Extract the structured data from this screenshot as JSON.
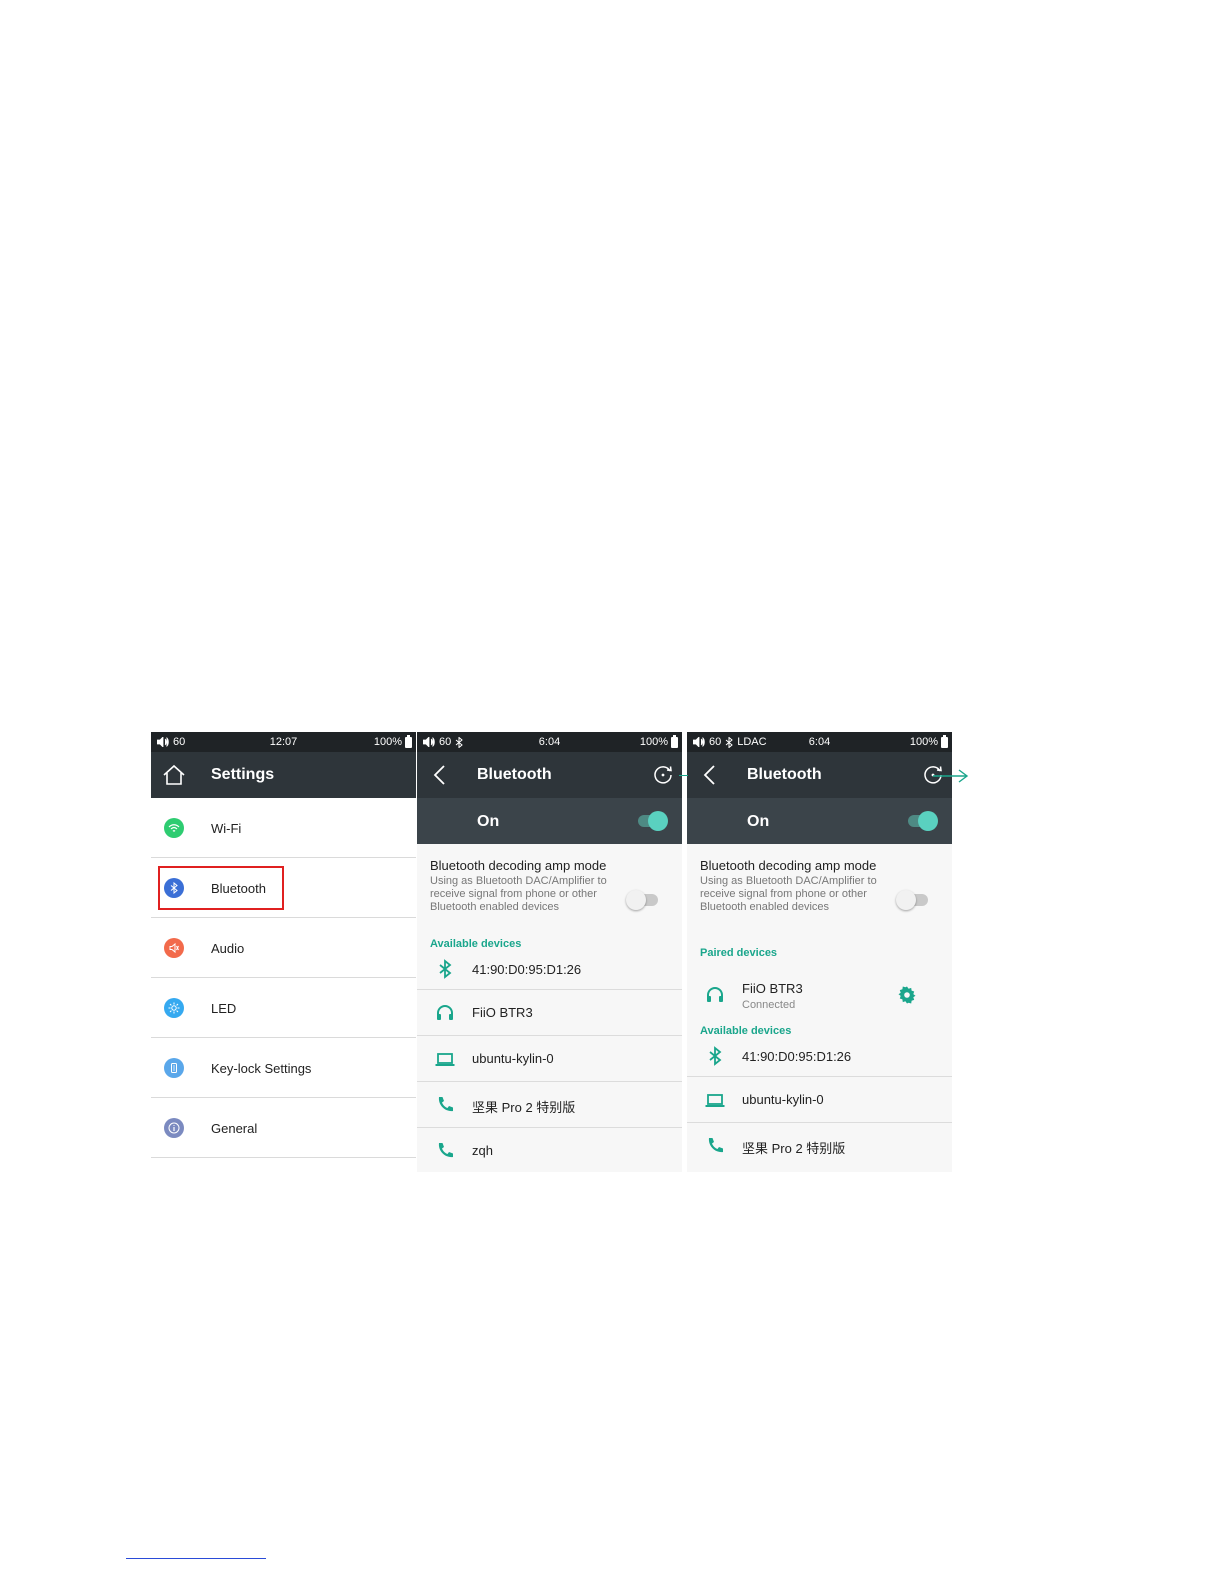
{
  "screens": [
    {
      "status": {
        "volume": "60",
        "bt_codec": "",
        "time": "12:07",
        "battery": "100%"
      },
      "header": {
        "title": "Settings",
        "nav_icon": "home-icon"
      },
      "menu": [
        {
          "label": "Wi-Fi",
          "icon": "wifi-icon",
          "color": "#2ecc71"
        },
        {
          "label": "Bluetooth",
          "icon": "bluetooth-icon",
          "color": "#3b6fd6",
          "highlighted": true
        },
        {
          "label": "Audio",
          "icon": "speaker-icon",
          "color": "#f26a4b"
        },
        {
          "label": "LED",
          "icon": "light-icon",
          "color": "#35a9f0"
        },
        {
          "label": "Key-lock Settings",
          "icon": "lock-icon",
          "color": "#5aa7ea"
        },
        {
          "label": "General",
          "icon": "info-icon",
          "color": "#7b8ac0"
        }
      ]
    },
    {
      "status": {
        "volume": "60",
        "bt_codec": "",
        "time": "6:04",
        "battery": "100%"
      },
      "header": {
        "title": "Bluetooth",
        "nav_icon": "back-icon",
        "action_icon": "refresh-icon"
      },
      "toggle": {
        "label": "On",
        "state": true
      },
      "amp": {
        "title": "Bluetooth decoding amp mode",
        "desc": "Using as Bluetooth DAC/Amplifier to receive signal from phone or other Bluetooth enabled devices",
        "state": false
      },
      "available_label": "Available devices",
      "available": [
        {
          "name": "41:90:D0:95:D1:26",
          "icon": "bluetooth-icon"
        },
        {
          "name": "FiiO BTR3",
          "icon": "headphones-icon"
        },
        {
          "name": "ubuntu-kylin-0",
          "icon": "laptop-icon"
        },
        {
          "name": "坚果 Pro 2 特别版",
          "icon": "phone-icon"
        },
        {
          "name": "zqh",
          "icon": "phone-icon"
        }
      ]
    },
    {
      "status": {
        "volume": "60",
        "bt_codec": "LDAC",
        "time": "6:04",
        "battery": "100%"
      },
      "header": {
        "title": "Bluetooth",
        "nav_icon": "back-icon",
        "action_icon": "refresh-icon"
      },
      "toggle": {
        "label": "On",
        "state": true
      },
      "amp": {
        "title": "Bluetooth decoding amp mode",
        "desc": "Using as Bluetooth DAC/Amplifier to receive signal from phone or other Bluetooth enabled devices",
        "state": false
      },
      "paired_label": "Paired devices",
      "paired": {
        "name": "FiiO BTR3",
        "status": "Connected",
        "icon": "headphones-icon",
        "action_icon": "gear-icon"
      },
      "available_label": "Available devices",
      "available": [
        {
          "name": "41:90:D0:95:D1:26",
          "icon": "bluetooth-icon"
        },
        {
          "name": "ubuntu-kylin-0",
          "icon": "laptop-icon"
        },
        {
          "name": "坚果 Pro 2 特别版",
          "icon": "phone-icon"
        }
      ]
    }
  ],
  "colors": {
    "accent": "#1aa68c",
    "highlight": "#e02020",
    "header": "#2e353a",
    "statusbar": "#1f2326"
  }
}
